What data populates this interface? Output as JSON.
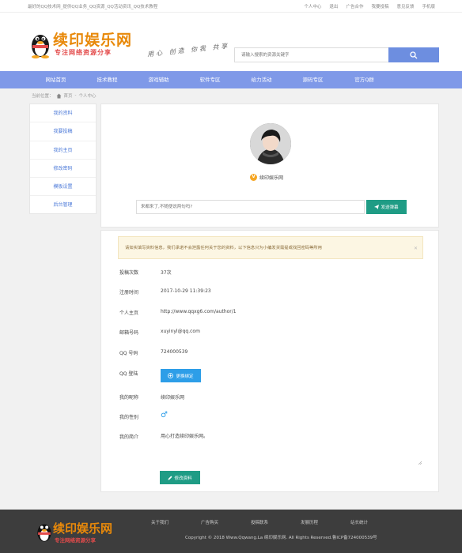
{
  "topbar": {
    "tagline": "最好的QQ技术网_提供QQ业务_QQ资源_QQ活动资讯_QQ技术教程",
    "links": [
      "个人中心",
      "退出",
      "广告合作",
      "我要投稿",
      "意见反馈",
      "手机版"
    ]
  },
  "header": {
    "logo_title": "续印娱乐网",
    "logo_sub": "专注网络资源分享",
    "slogan": "用心 创造 你我 共享",
    "search_placeholder": "请输入搜索的资源关键字"
  },
  "nav": [
    "网站首页",
    "技术教程",
    "游戏辅助",
    "软件专区",
    "给力活动",
    "源码专区",
    "官方Q群"
  ],
  "breadcrumb": {
    "prefix": "当前位置：",
    "home": "首页",
    "sep": "-",
    "current": "个人中心"
  },
  "sidebar": [
    "我的资料",
    "我要投稿",
    "我的主页",
    "修改密码",
    "模板设置",
    "后台管理"
  ],
  "profile": {
    "username": "续印娱乐网",
    "badge": "V",
    "message_placeholder": "来都来了,不随便说两句吗?",
    "send_label": "发送弹幕"
  },
  "details": {
    "notice": "请如实填写资料信息，我们承诺不会泄露任何关于您的资料，以下信息只为小编发货需提或找回密码等所用",
    "rows": [
      {
        "label": "投稿次数",
        "value": "37次"
      },
      {
        "label": "注册时间",
        "value": "2017-10-29 11:39:23"
      },
      {
        "label": "个人主页",
        "value": "http://www.qqxg6.com/author/1"
      },
      {
        "label": "邮箱号码",
        "value": "xuyinyl@qq.com"
      },
      {
        "label": "QQ 号码",
        "value": "724000539"
      },
      {
        "label": "QQ 登陆",
        "value": ""
      },
      {
        "label": "我的昵称",
        "value": "续印娱乐网"
      },
      {
        "label": "我的性别",
        "value": "♂"
      },
      {
        "label": "我的简介",
        "value": "用心打造续印娱乐网。"
      }
    ],
    "bind_label": "更换绑定",
    "save_label": "修改资料"
  },
  "footer": {
    "logo_title": "续印娱乐网",
    "logo_sub": "专注网络资源分享",
    "links": [
      "关于我们",
      "广告购买",
      "投稿联系",
      "发展历程",
      "站长统计"
    ],
    "copyright": "Copyright © 2018 Www.Qqwang.La 续印娱乐网. All Rights Reserved.鲁ICP备724000539号"
  },
  "colors": {
    "nav": "#7f99e8",
    "accent_green": "#1f9c85",
    "link_blue": "#4a78d8",
    "bind_blue": "#2d9ee8",
    "logo_orange": "#e8890a",
    "logo_red": "#e34b4b"
  }
}
